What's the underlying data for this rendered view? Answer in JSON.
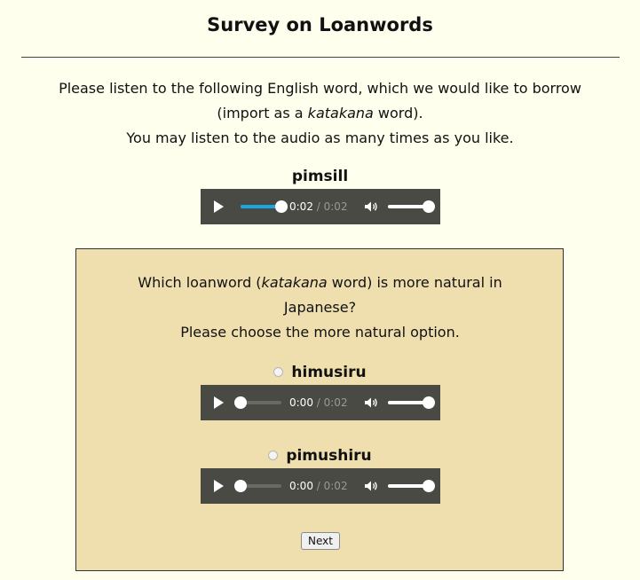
{
  "page": {
    "title": "Survey on Loanwords"
  },
  "intro": {
    "line1_before": "Please listen to the following English word, which we would like to borrow",
    "line2_before": "(import as a ",
    "line2_italic": "katakana",
    "line2_after": " word).",
    "line3": "You may listen to the audio as many times as you like."
  },
  "stimulus": {
    "word": "pimsill",
    "player": {
      "current_time": "0:02",
      "separator": " / ",
      "duration": "0:02",
      "progress": 1.0,
      "volume": 1.0,
      "accent_color": "#1aa6e0"
    }
  },
  "question": {
    "line1_before": "Which loanword (",
    "line1_italic": "katakana",
    "line1_after": " word) is more natural in",
    "line2": "Japanese?",
    "line3": "Please choose the more natural option."
  },
  "options": [
    {
      "label": "himusiru",
      "selected": false,
      "player": {
        "current_time": "0:00",
        "separator": " / ",
        "duration": "0:02",
        "progress": 0.0,
        "volume": 1.0
      }
    },
    {
      "label": "pimushiru",
      "selected": false,
      "player": {
        "current_time": "0:00",
        "separator": " / ",
        "duration": "0:02",
        "progress": 0.0,
        "volume": 1.0
      }
    }
  ],
  "next_button": {
    "label": "Next"
  },
  "colors": {
    "page_background": "#ffffee",
    "question_box_background": "#efdfaf",
    "player_background": "#4a4a44"
  },
  "icons": {
    "play": "play-icon",
    "volume": "volume-icon"
  }
}
